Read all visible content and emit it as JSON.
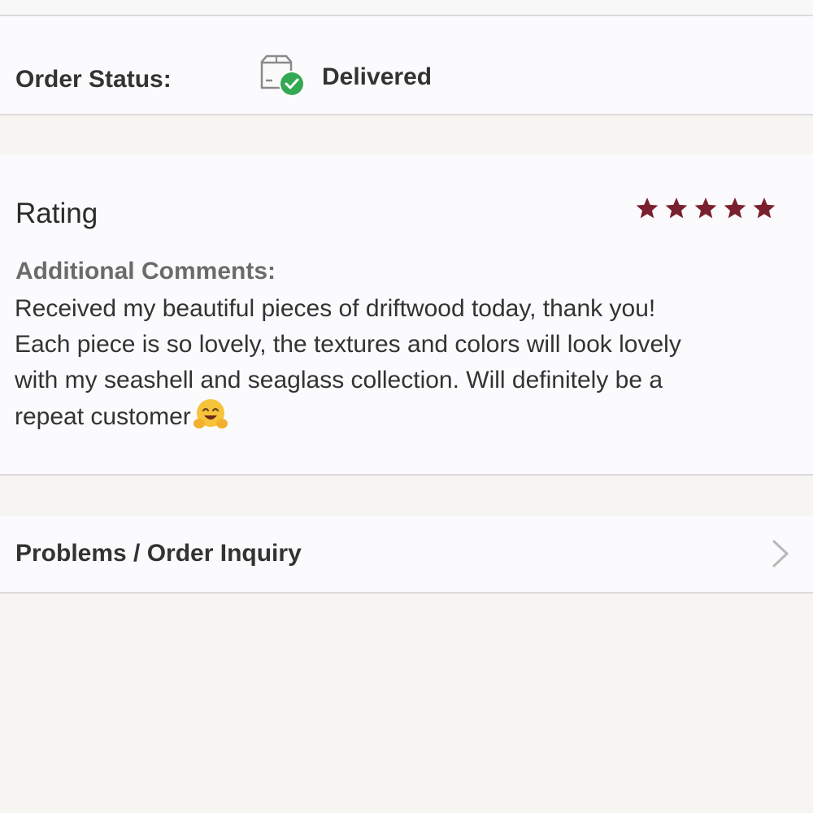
{
  "order_status": {
    "label": "Order Status:",
    "value": "Delivered",
    "icon": "package-delivered-icon",
    "badge_color": "#34a853"
  },
  "review": {
    "rating_label": "Rating",
    "rating": 5,
    "rating_max": 5,
    "star_color": "#7a1f2e",
    "comments_label": "Additional Comments:",
    "comments": "Received my beautiful pieces of driftwood today, thank you!\nEach piece is so lovely, the textures and colors will look lovely\nwith my seashell and seaglass collection. Will definitely be a\nrepeat customer",
    "emoji": "hugging-face-emoji"
  },
  "inquiry": {
    "label": "Problems / Order Inquiry",
    "icon": "chevron-right-icon"
  }
}
